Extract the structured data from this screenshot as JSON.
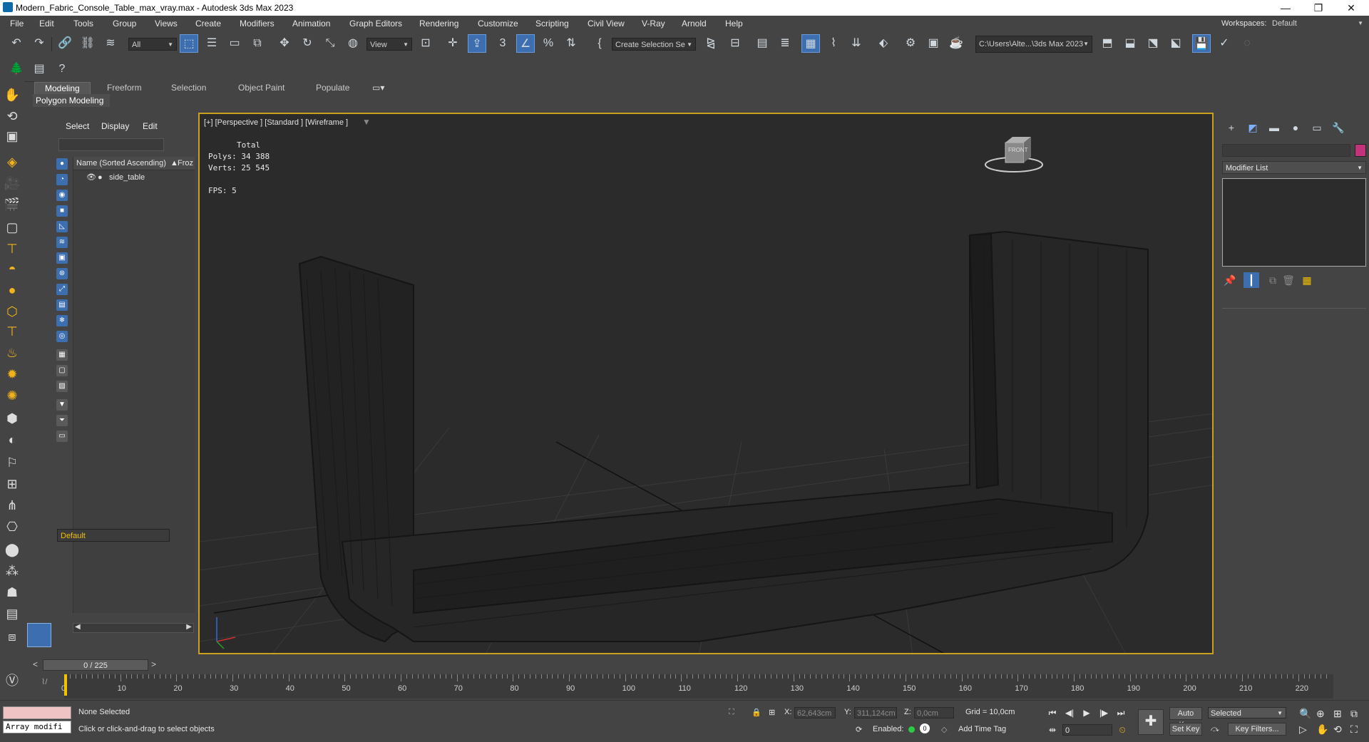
{
  "window": {
    "title": "Modern_Fabric_Console_Table_max_vray.max - Autodesk 3ds Max 2023",
    "minimize": "—",
    "restore": "❐",
    "close": "✕"
  },
  "menu": [
    "File",
    "Edit",
    "Tools",
    "Group",
    "Views",
    "Create",
    "Modifiers",
    "Animation",
    "Graph Editors",
    "Rendering",
    "Customize",
    "Scripting",
    "Civil View",
    "V-Ray",
    "Arnold",
    "Help"
  ],
  "workspace": {
    "label": "Workspaces:",
    "value": "Default"
  },
  "toolbar": {
    "selection_filter": "All",
    "ref_coord": "View",
    "named_selection": "Create Selection Se",
    "project_path": "C:\\Users\\Alte...\\3ds Max 2023"
  },
  "ribbon": {
    "tabs": [
      "Modeling",
      "Freeform",
      "Selection",
      "Object Paint",
      "Populate"
    ],
    "active_tab": "Modeling",
    "panel": "Polygon Modeling"
  },
  "scene_explorer": {
    "tabs": [
      "Select",
      "Display",
      "Edit"
    ],
    "column_name": "Name (Sorted Ascending)",
    "column_sort": "▲",
    "column_frozen": "Froz",
    "objects": [
      "side_table"
    ],
    "layer": "Default"
  },
  "viewport": {
    "label": "[+] [Perspective ] [Standard ] [Wireframe ]",
    "stats_total_label": "Total",
    "polys_label": "Polys:",
    "polys_value": "34 388",
    "verts_label": "Verts:",
    "verts_value": "25 545",
    "fps_label": "FPS:",
    "fps_value": "5",
    "viewcube_label": "FRONT"
  },
  "command_panel": {
    "modifier_list": "Modifier List",
    "object_color": "#c4327a"
  },
  "timeline": {
    "frame_display": "0 / 225",
    "ticks": [
      "0",
      "10",
      "20",
      "30",
      "40",
      "50",
      "60",
      "70",
      "80",
      "90",
      "100",
      "110",
      "120",
      "130",
      "140",
      "150",
      "160",
      "170",
      "180",
      "190",
      "200",
      "210",
      "220"
    ]
  },
  "status": {
    "maxscript_line2": "Array modifi",
    "selection": "None Selected",
    "prompt": "Click or click-and-drag to select objects",
    "x_label": "X:",
    "x_value": "62,643cm",
    "y_label": "Y:",
    "y_value": "311,124cm",
    "z_label": "Z:",
    "z_value": "0,0cm",
    "grid": "Grid = 10,0cm",
    "enabled": "Enabled:",
    "add_time_tag": "Add Time Tag",
    "frame": "0",
    "auto_key": "Auto Key",
    "set_key": "Set Key",
    "key_mode": "Selected",
    "key_filters": "Key Filters..."
  }
}
